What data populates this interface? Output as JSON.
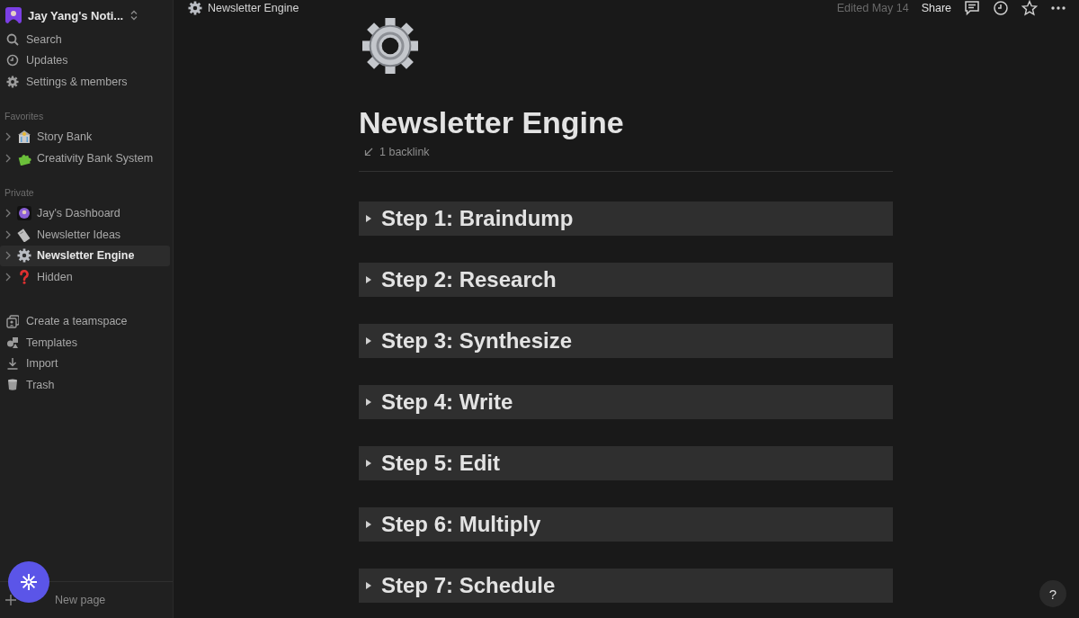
{
  "workspace": {
    "name": "Jay Yang's Noti..."
  },
  "sidebar": {
    "nav": [
      "Search",
      "Updates",
      "Settings & members"
    ],
    "sections": [
      {
        "title": "Favorites",
        "pages": [
          {
            "label": "Story Bank",
            "selected": false
          },
          {
            "label": "Creativity Bank System",
            "selected": false
          }
        ]
      },
      {
        "title": "Private",
        "pages": [
          {
            "label": "Jay's Dashboard",
            "selected": false
          },
          {
            "label": "Newsletter Ideas",
            "selected": false
          },
          {
            "label": "Newsletter Engine",
            "selected": true
          },
          {
            "label": "Hidden",
            "selected": false
          }
        ]
      }
    ],
    "tools": [
      "Create a teamspace",
      "Templates",
      "Import",
      "Trash"
    ],
    "new_page": "New page"
  },
  "topbar": {
    "breadcrumb": "Newsletter Engine",
    "edited": "Edited May 14",
    "share": "Share"
  },
  "page": {
    "title": "Newsletter Engine",
    "backlinks": "1 backlink",
    "toggles": [
      {
        "heading": "Step 1: Braindump",
        "expanded": false
      },
      {
        "heading": "Step 2: Research",
        "expanded": false
      },
      {
        "heading": "Step 3: Synthesize",
        "expanded": false
      },
      {
        "heading": "Step 4: Write",
        "expanded": false
      },
      {
        "heading": "Step 5: Edit",
        "expanded": false
      },
      {
        "heading": "Step 6: Multiply",
        "expanded": false
      },
      {
        "heading": "Step 7: Schedule",
        "expanded": false
      }
    ]
  },
  "help": "?"
}
